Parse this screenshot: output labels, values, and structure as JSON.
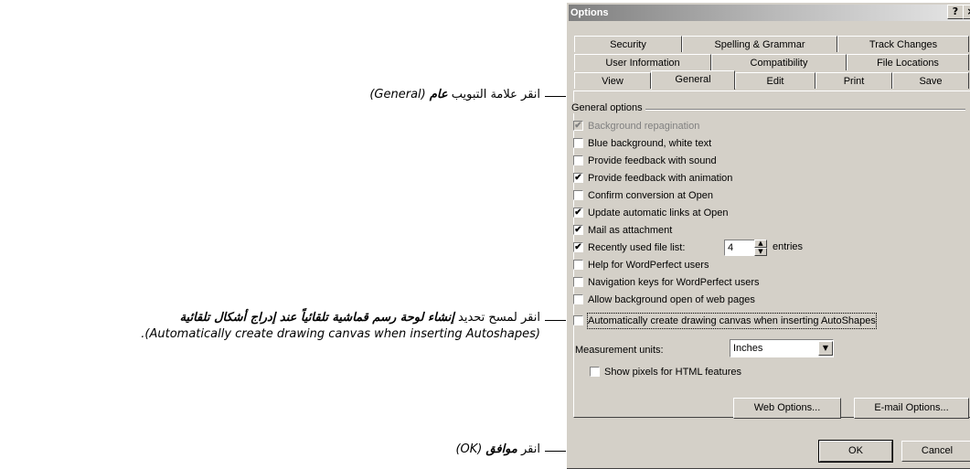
{
  "callouts": {
    "tab_general": {
      "prefix": "انقر علامة التبويب ",
      "bold": "عام",
      "english": "(General)"
    },
    "canvas_option": {
      "prefix": "انقر لمسح تحديد ",
      "bold": "إنشاء لوحة رسم قماشية تلقائياً عند إدراج أشكال تلقائية",
      "english_line2": "(Automatically create drawing canvas when inserting Autoshapes)."
    },
    "ok_button": {
      "prefix": "انقر ",
      "bold": "موافق",
      "english": "(OK)"
    }
  },
  "dialog": {
    "title": "Options",
    "help_button": "?",
    "close_button": "×",
    "tabs_row1": [
      "Security",
      "Spelling & Grammar",
      "Track Changes"
    ],
    "tabs_row2": [
      "User Information",
      "Compatibility",
      "File Locations"
    ],
    "tabs_row3": [
      "View",
      "General",
      "Edit",
      "Print",
      "Save"
    ],
    "active_tab": "General",
    "group_label": "General options",
    "options": [
      {
        "label": "Background repagination",
        "checked": true,
        "disabled": true
      },
      {
        "label": "Blue background, white text",
        "checked": false
      },
      {
        "label": "Provide feedback with sound",
        "checked": false
      },
      {
        "label": "Provide feedback with animation",
        "checked": true
      },
      {
        "label": "Confirm conversion at Open",
        "checked": false
      },
      {
        "label": "Update automatic links at Open",
        "checked": true
      },
      {
        "label": "Mail as attachment",
        "checked": true
      },
      {
        "label": "Recently used file list:",
        "checked": true
      },
      {
        "label": "Help for WordPerfect users",
        "checked": false
      },
      {
        "label": "Navigation keys for WordPerfect users",
        "checked": false
      },
      {
        "label": "Allow background open of web pages",
        "checked": false
      },
      {
        "label": "Automatically create drawing canvas when inserting AutoShapes",
        "checked": false
      }
    ],
    "recent_files_value": "4",
    "recent_files_suffix": "entries",
    "measurement_label": "Measurement units:",
    "measurement_value": "Inches",
    "show_pixels_label": "Show pixels for HTML features",
    "show_pixels_checked": false,
    "web_options_button": "Web Options...",
    "email_options_button": "E-mail Options...",
    "ok_button": "OK",
    "cancel_button": "Cancel"
  }
}
